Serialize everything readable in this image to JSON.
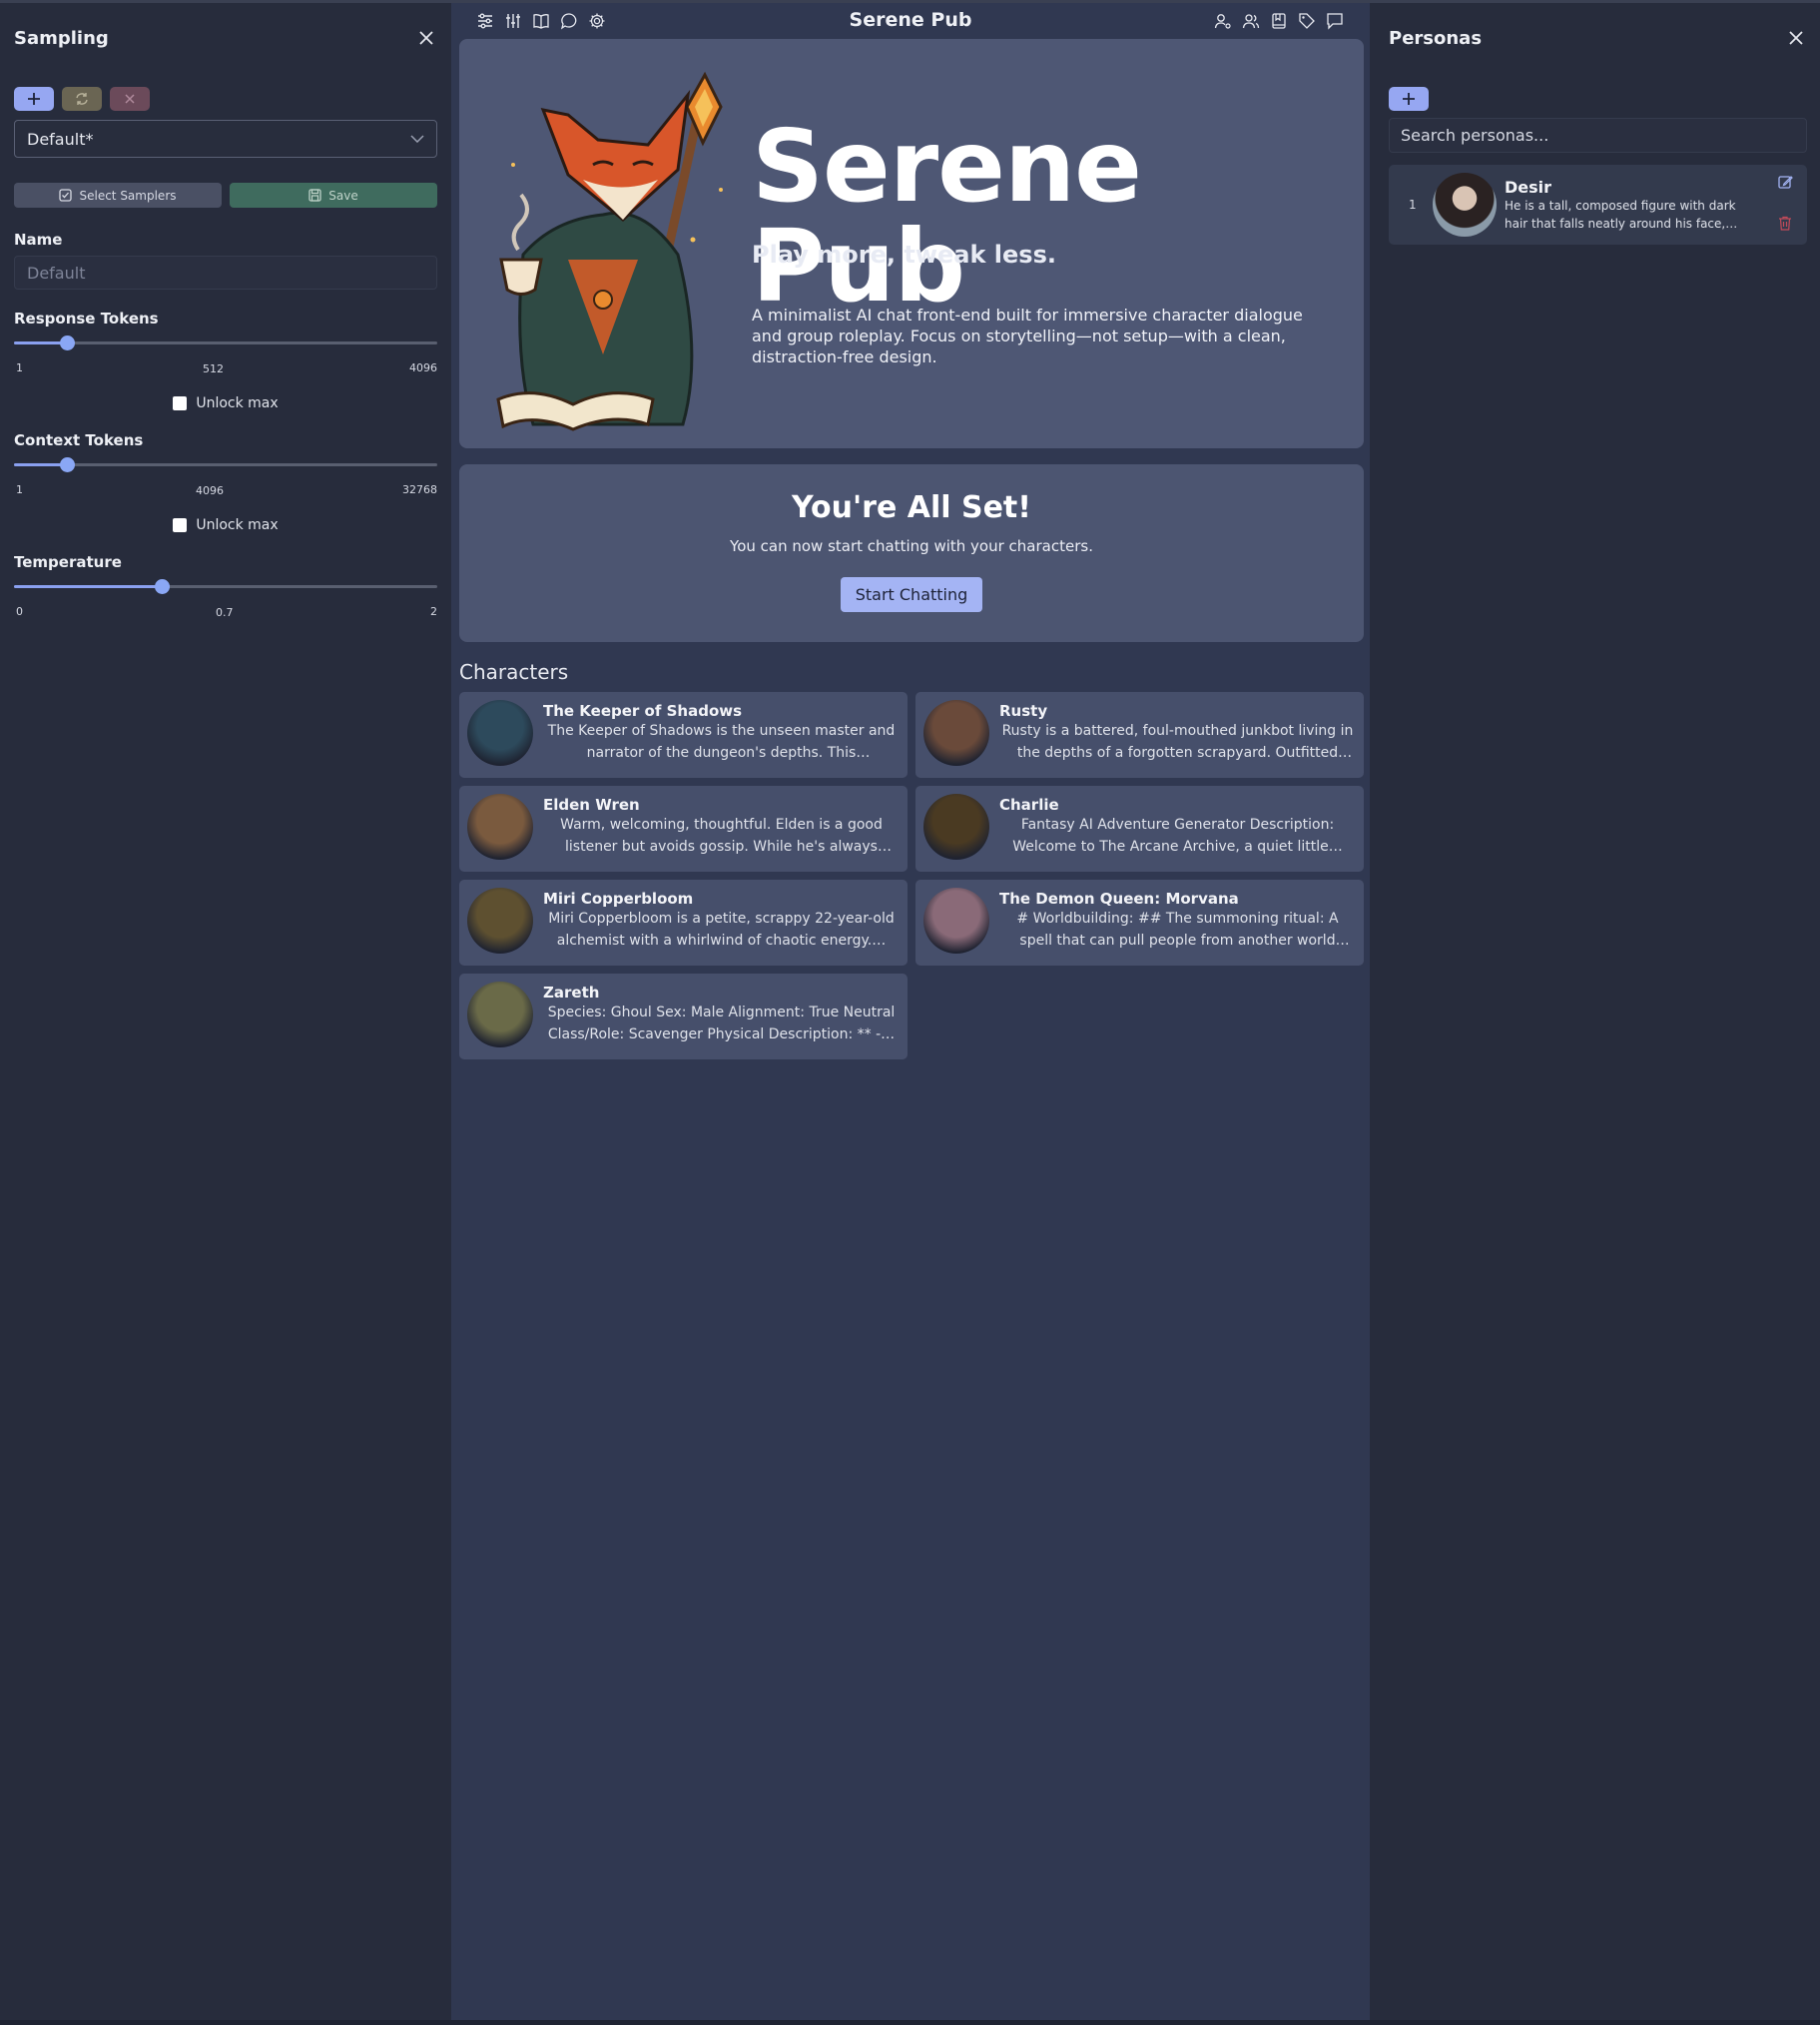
{
  "app": {
    "title": "Serene Pub"
  },
  "sampling": {
    "title": "Sampling",
    "preset_value": "Default*",
    "select_samplers_label": "Select Samplers",
    "save_label": "Save",
    "name_label": "Name",
    "name_placeholder": "Default",
    "sliders": [
      {
        "label": "Response Tokens",
        "min": "1",
        "max": "4096",
        "value": "512",
        "fraction": 0.124,
        "unlock_label": "Unlock max"
      },
      {
        "label": "Context Tokens",
        "min": "1",
        "max": "32768",
        "value": "4096",
        "fraction": 0.124,
        "unlock_label": "Unlock max"
      },
      {
        "label": "Temperature",
        "min": "0",
        "max": "2",
        "value": "0.7",
        "fraction": 0.35
      }
    ]
  },
  "hero": {
    "title": "Serene Pub",
    "tagline": "Play more, tweak less.",
    "description": "A minimalist AI chat front-end built for immersive character dialogue and group roleplay. Focus on storytelling—not setup—with a clean, distraction-free design."
  },
  "setup": {
    "title": "You're All Set!",
    "subtitle": "You can now start chatting with your characters.",
    "button_label": "Start Chatting"
  },
  "characters": {
    "title": "Characters",
    "items": [
      {
        "name": "The Keeper of Shadows",
        "desc": "The Keeper of Shadows is the unseen master and narrator of the dungeon's depths. This enigmatic…",
        "avatar_color": "#2d4a5c"
      },
      {
        "name": "Rusty",
        "desc": "Rusty is a battered, foul-mouthed junkbot living in the depths of a forgotten scrapyard. Outfitted wit…",
        "avatar_color": "#6a4a3a"
      },
      {
        "name": "Elden Wren",
        "desc": "Warm, welcoming, thoughtful. Elden is a good listener but avoids gossip. While he's always ready …",
        "avatar_color": "#7a5a3e"
      },
      {
        "name": "Charlie",
        "desc": "Fantasy AI Adventure Generator Description: Welcome to The Arcane Archive, a quiet little…",
        "avatar_color": "#4a3a22"
      },
      {
        "name": "Miri Copperbloom",
        "desc": "Miri Copperbloom is a petite, scrappy 22-year-old alchemist with a whirlwind of chaotic energy.…",
        "avatar_color": "#5e5030"
      },
      {
        "name": "The Demon Queen: Morvana",
        "desc": "# Worldbuilding: ## The summoning ritual: A spell that can pull people from another world when the…",
        "avatar_color": "#8a6a78"
      },
      {
        "name": "Zareth",
        "desc": "Species: Ghoul Sex: Male Alignment: True Neutral Class/Role: Scavenger Physical Description: ** -…",
        "avatar_color": "#6a6a48"
      }
    ]
  },
  "personas": {
    "title": "Personas",
    "search_placeholder": "Search personas...",
    "items": [
      {
        "index": "1",
        "name": "Desir",
        "desc": "He is a tall, composed figure with dark hair that falls neatly around his face,…"
      }
    ]
  },
  "icons": {
    "left_toolbar": [
      "sliders-icon",
      "sampler-settings-icon",
      "book-icon",
      "chat-bubble-icon",
      "gear-icon"
    ],
    "right_toolbar": [
      "persona-icon",
      "characters-icon",
      "lorebook-icon",
      "tag-icon",
      "chats-icon"
    ]
  },
  "colors": {
    "accent": "#a4b4f4",
    "panel": "#272c3c",
    "center": "#303851",
    "card": "#464f6b"
  }
}
